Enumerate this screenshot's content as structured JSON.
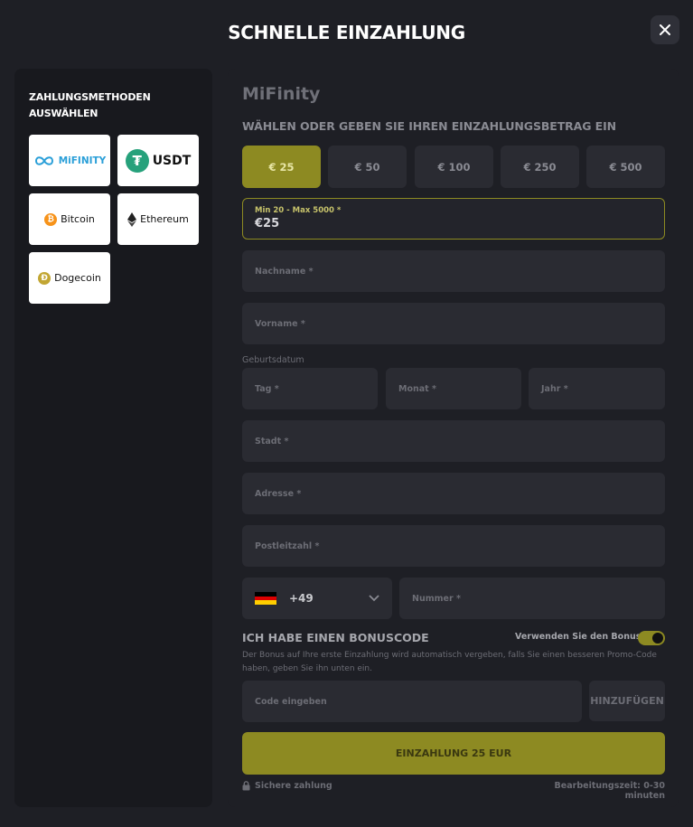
{
  "modal": {
    "title": "SCHNELLE EINZAHLUNG",
    "close_icon": "close-icon"
  },
  "payment_methods": {
    "heading": "ZAHLUNGSMETHODEN AUSWÄHLEN",
    "items": [
      {
        "label": "MiFINITY",
        "icon": "mifinity-logo-icon",
        "color": "#2a9fd8"
      },
      {
        "label": "USDT",
        "icon": "tether-icon",
        "color": "#26a17b"
      },
      {
        "label": "Bitcoin",
        "icon": "bitcoin-icon",
        "color": "#f7931a"
      },
      {
        "label": "Ethereum",
        "icon": "ethereum-icon",
        "color": "#111111"
      },
      {
        "label": "Dogecoin",
        "icon": "dogecoin-icon",
        "color": "#c2a633"
      }
    ]
  },
  "deposit": {
    "brand": "MiFinity",
    "section_title": "WÄHLEN ODER GEBEN SIE IHREN EINZAHLUNGSBETRAG EIN",
    "amounts": [
      "€ 25",
      "€ 50",
      "€ 100",
      "€ 250",
      "€ 500"
    ],
    "selected_amount_index": 0,
    "amount_field": {
      "label": "Min 20 - Max 5000 *",
      "value": "€25"
    },
    "fields": {
      "last_name": "Nachname *",
      "first_name": "Vorname *",
      "birthdate_label": "Geburtsdatum",
      "day": "Tag *",
      "month": "Monat *",
      "year": "Jahr *",
      "city": "Stadt *",
      "address": "Adresse *",
      "zip": "Postleitzahl *",
      "phone_prefix": "+49",
      "phone_number": "Nummer *"
    },
    "bonus": {
      "title": "ICH HABE EINEN BONUSCODE",
      "toggle_label": "Verwenden Sie den Bonus",
      "toggle_on": true,
      "description": "Der Bonus auf Ihre erste Einzahlung wird automatisch vergeben, falls Sie einen besseren Promo-Code haben, geben Sie ihn unten ein.",
      "code_placeholder": "Code eingeben",
      "add_label": "HINZUFÜGEN"
    },
    "submit_label": "EINZAHLUNG 25 EUR",
    "secure_label": "Sichere zahlung",
    "processing_time": "Bearbeitungszeit: 0-30 minuten"
  },
  "colors": {
    "accent": "#8d8a22",
    "background": "#1e1f25",
    "field": "#2a2b32"
  }
}
